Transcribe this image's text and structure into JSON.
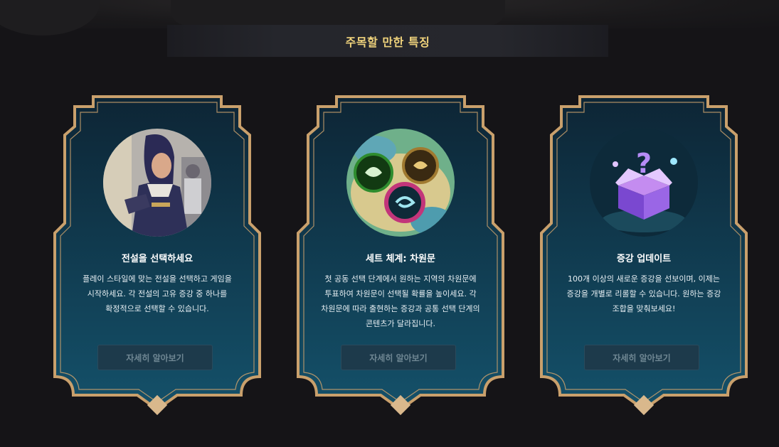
{
  "header": {
    "title": "주목할 만한 특징"
  },
  "colors": {
    "frame": "#c9a06c",
    "card_top": "#0d2535",
    "card_bottom": "#14516a",
    "title": "#f0d37c",
    "button": "#1d3a4b"
  },
  "cards": [
    {
      "title": "전설을 선택하세요",
      "description": "플레이 스타일에 맞는 전설을 선택하고 게임을 시작하세요. 각 전설의 고유 증강 중 하나를 확정적으로 선택할 수 있습니다.",
      "button": "자세히 알아보기",
      "icon": "legend-portrait"
    },
    {
      "title": "세트 체계: 차원문",
      "description": "첫 공동 선택 단계에서 원하는 지역의 차원문에 투표하여 차원문이 선택될 확률을 높이세요. 각 차원문에 따라 출현하는 증강과 공통 선택 단계의 콘텐츠가 달라집니다.",
      "button": "자세히 알아보기",
      "icon": "portal-map"
    },
    {
      "title": "증강 업데이트",
      "description": "100개 이상의 새로운 증강을 선보이며, 이제는 증강을 개별로 리롤할 수 있습니다. 원하는 증강 조합을 맞춰보세요!",
      "button": "자세히 알아보기",
      "icon": "augment-mystery-box"
    }
  ]
}
